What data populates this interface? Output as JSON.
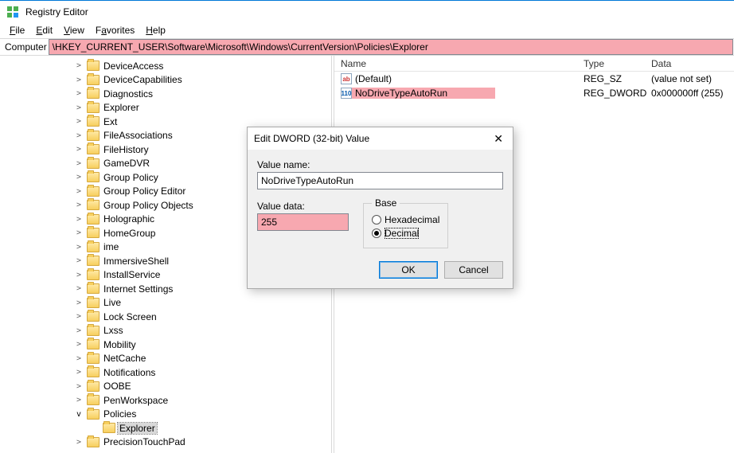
{
  "title": "Registry Editor",
  "menu": {
    "file": "File",
    "edit": "Edit",
    "view": "View",
    "favorites": "Favorites",
    "help": "Help"
  },
  "address": {
    "label": "Computer",
    "path": "\\HKEY_CURRENT_USER\\Software\\Microsoft\\Windows\\CurrentVersion\\Policies\\Explorer"
  },
  "tree": {
    "items": [
      "DeviceAccess",
      "DeviceCapabilities",
      "Diagnostics",
      "Explorer",
      "Ext",
      "FileAssociations",
      "FileHistory",
      "GameDVR",
      "Group Policy",
      "Group Policy Editor",
      "Group Policy Objects",
      "Holographic",
      "HomeGroup",
      "ime",
      "ImmersiveShell",
      "InstallService",
      "Internet Settings",
      "Live",
      "Lock Screen",
      "Lxss",
      "Mobility",
      "NetCache",
      "Notifications",
      "OOBE",
      "PenWorkspace",
      "Policies"
    ],
    "policies_child": "Explorer",
    "next_item": "PrecisionTouchPad"
  },
  "lv": {
    "columns": {
      "name": "Name",
      "type": "Type",
      "data": "Data"
    },
    "rows": [
      {
        "name": "(Default)",
        "type": "REG_SZ",
        "data": "(value not set)",
        "kind": "sz",
        "hl": false
      },
      {
        "name": "NoDriveTypeAutoRun",
        "type": "REG_DWORD",
        "data": "0x000000ff (255)",
        "kind": "dw",
        "hl": true
      }
    ]
  },
  "dlg": {
    "title": "Edit DWORD (32-bit) Value",
    "value_name_label": "Value name:",
    "value_name": "NoDriveTypeAutoRun",
    "value_data_label": "Value data:",
    "value_data": "255",
    "base_label": "Base",
    "hex": "Hexadecimal",
    "dec": "Decimal",
    "ok": "OK",
    "cancel": "Cancel"
  }
}
